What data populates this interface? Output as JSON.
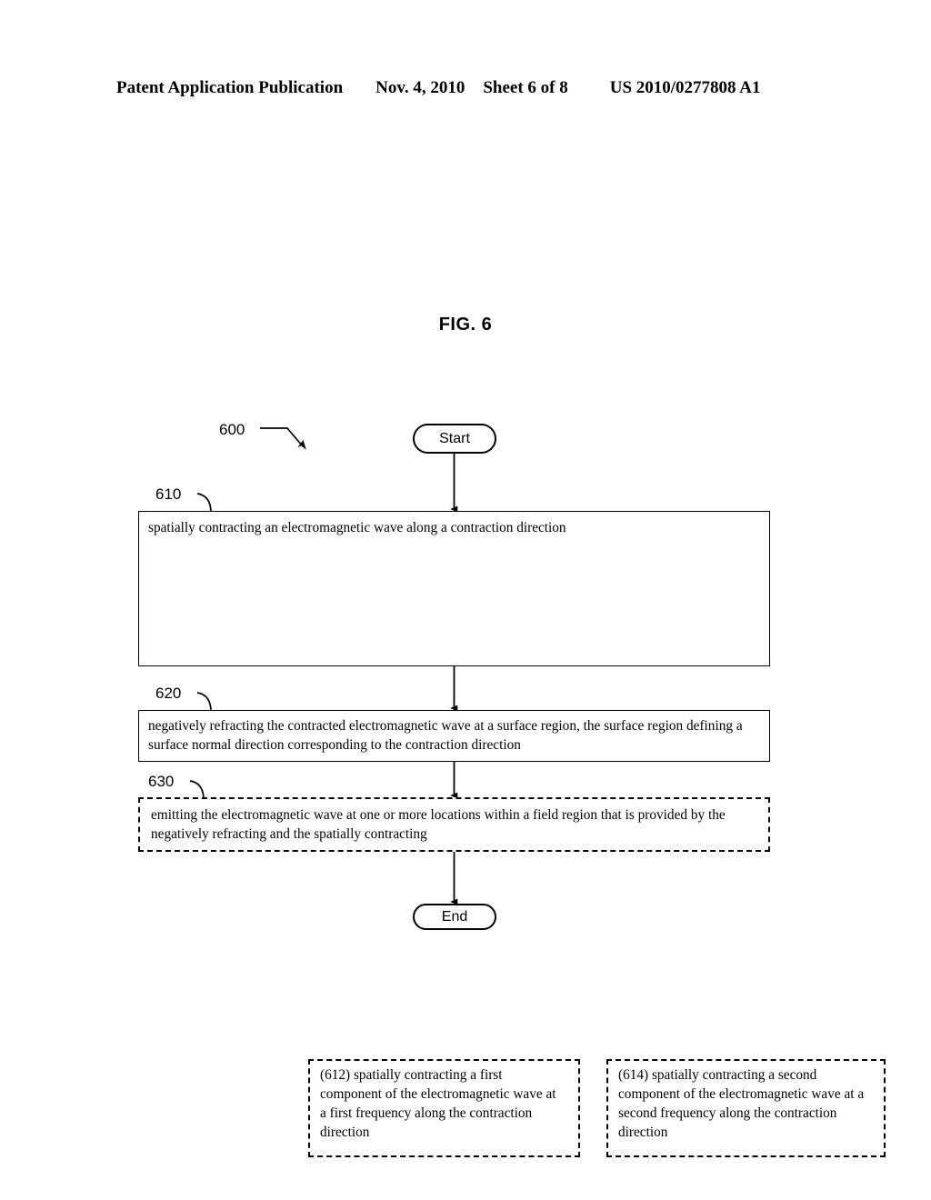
{
  "header": {
    "publication": "Patent Application Publication",
    "date": "Nov. 4, 2010",
    "sheet": "Sheet 6 of 8",
    "document_number": "US 2010/0277808 A1"
  },
  "figure": {
    "caption": "FIG. 6",
    "flow_reference": "600"
  },
  "flow": {
    "start_label": "Start",
    "end_label": "End",
    "steps": [
      {
        "ref": "610",
        "style": "solid",
        "text": "spatially contracting an electromagnetic wave along a contraction direction",
        "substeps": [
          {
            "ref": "612",
            "style": "dashed",
            "text": "(612) spatially contracting a first component of the electromagnetic wave at a first frequency along the contraction direction"
          },
          {
            "ref": "614",
            "style": "dashed",
            "text": "(614) spatially contracting a second component of the electromagnetic wave at a second frequency along the contraction direction"
          }
        ]
      },
      {
        "ref": "620",
        "style": "solid",
        "text": "negatively refracting the contracted electromagnetic wave at a surface region, the surface region defining a surface normal direction corresponding to the contraction direction",
        "substeps": []
      },
      {
        "ref": "630",
        "style": "dashed",
        "text": "emitting the electromagnetic wave at one or more locations within a field region that is provided by the negatively refracting and the spatially contracting",
        "substeps": []
      }
    ]
  },
  "colors": {
    "ink": "#000000",
    "paper": "#ffffff"
  }
}
